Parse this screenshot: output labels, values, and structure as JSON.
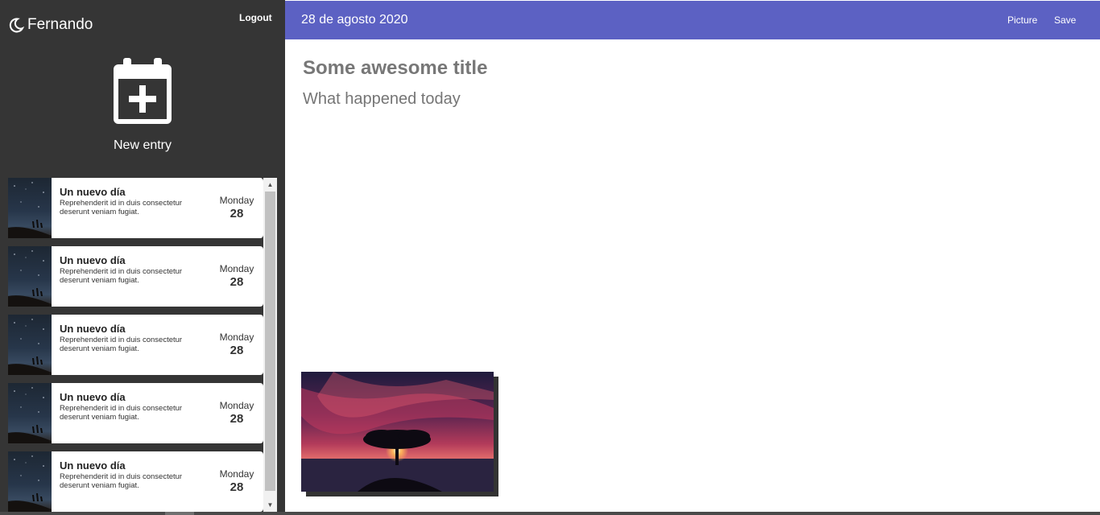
{
  "sidebar": {
    "user_name": "Fernando",
    "brand_icon": "moon-icon",
    "logout_label": "Logout",
    "new_entry_label": "New entry",
    "new_entry_icon": "calendar-plus-icon",
    "entries": [
      {
        "title": "Un nuevo día",
        "text": "Reprehenderit id in duis consectetur deserunt veniam fugiat.",
        "day": "Monday",
        "date": "28"
      },
      {
        "title": "Un nuevo día",
        "text": "Reprehenderit id in duis consectetur deserunt veniam fugiat.",
        "day": "Monday",
        "date": "28"
      },
      {
        "title": "Un nuevo día",
        "text": "Reprehenderit id in duis consectetur deserunt veniam fugiat.",
        "day": "Monday",
        "date": "28"
      },
      {
        "title": "Un nuevo día",
        "text": "Reprehenderit id in duis consectetur deserunt veniam fugiat.",
        "day": "Monday",
        "date": "28"
      },
      {
        "title": "Un nuevo día",
        "text": "Reprehenderit id in duis consectetur deserunt veniam fugiat.",
        "day": "Monday",
        "date": "28"
      }
    ]
  },
  "topbar": {
    "date": "28 de agosto 2020",
    "picture_label": "Picture",
    "save_label": "Save"
  },
  "editor": {
    "title_value": "Some awesome title",
    "body_placeholder": "What happened today"
  },
  "colors": {
    "sidebar_bg": "#353535",
    "accent": "#5c61c3"
  }
}
